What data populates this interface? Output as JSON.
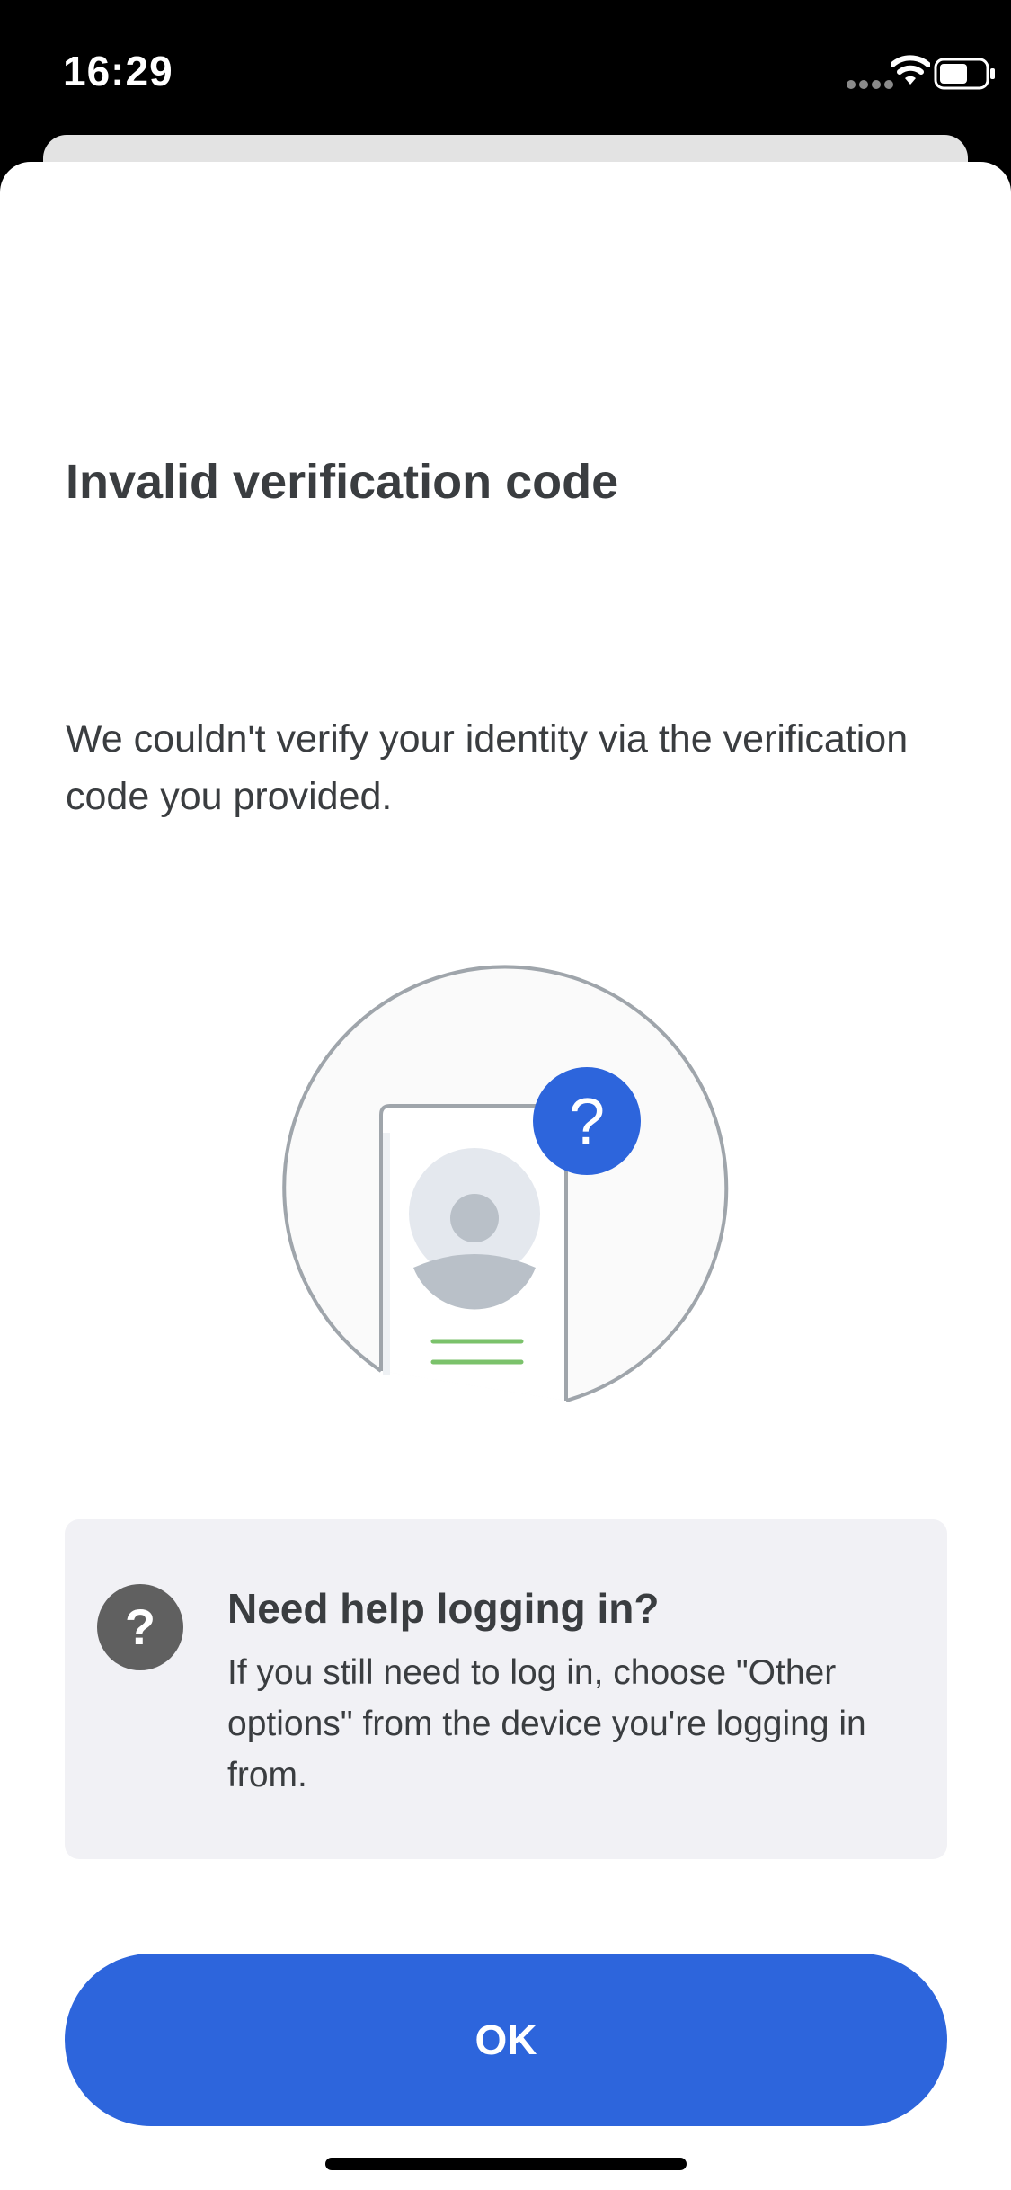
{
  "status_bar": {
    "time": "16:29"
  },
  "dialog": {
    "title": "Invalid verification code",
    "message": "We couldn't verify your identity via the verification code you provided."
  },
  "help": {
    "icon": "question-icon",
    "title": "Need help logging in?",
    "body": "If you still need to log in, choose \"Other options\" from the device you're logging in from."
  },
  "actions": {
    "ok_label": "OK"
  },
  "colors": {
    "accent": "#2d65dc",
    "text": "#3a3d40",
    "help_card_bg": "#f1f1f5",
    "help_icon_bg": "#606060",
    "green_lines": "#7bc26b"
  }
}
